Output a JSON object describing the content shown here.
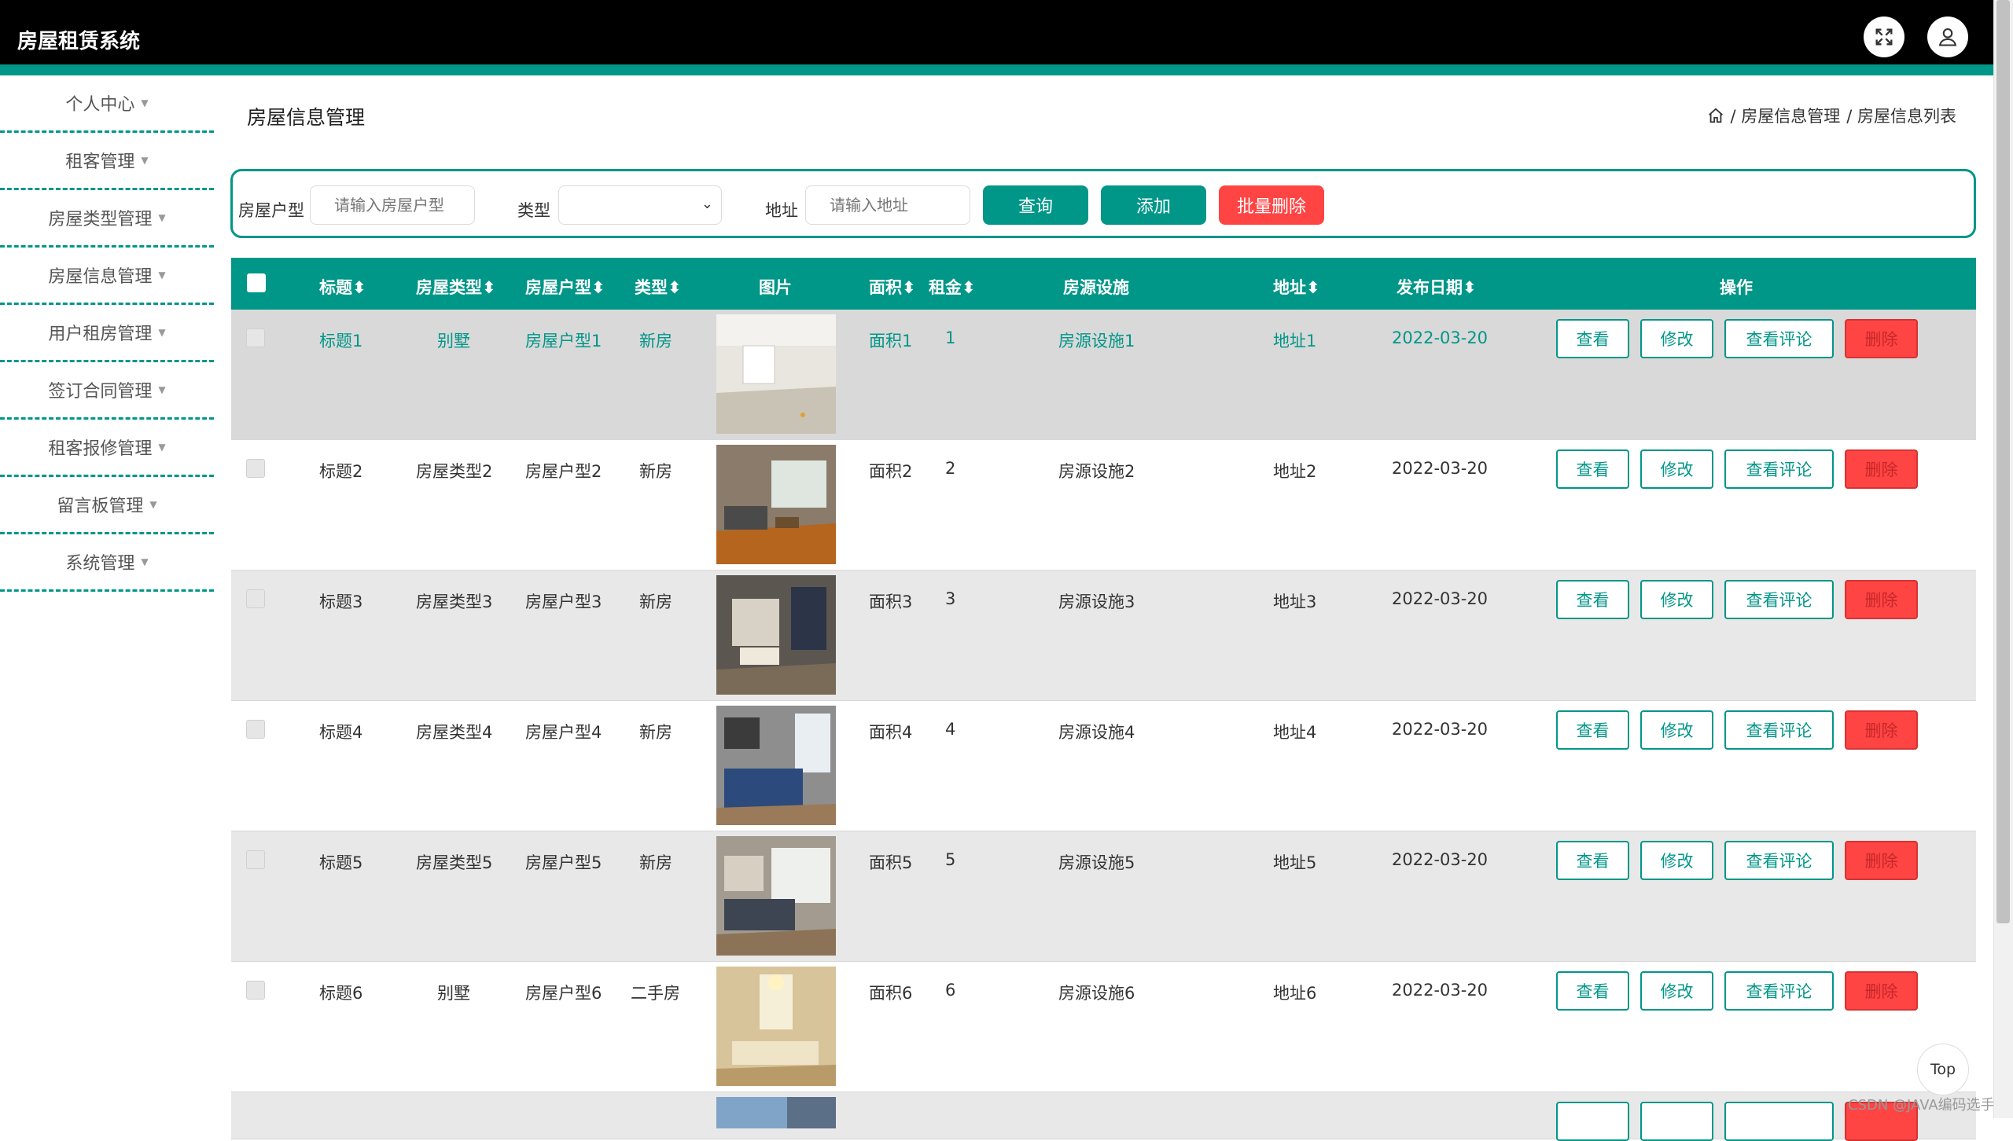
{
  "app": {
    "title": "房屋租赁系统"
  },
  "sidebar": {
    "items": [
      {
        "label": "个人中心"
      },
      {
        "label": "租客管理"
      },
      {
        "label": "房屋类型管理"
      },
      {
        "label": "房屋信息管理"
      },
      {
        "label": "用户租房管理"
      },
      {
        "label": "签订合同管理"
      },
      {
        "label": "租客报修管理"
      },
      {
        "label": "留言板管理"
      },
      {
        "label": "系统管理"
      }
    ]
  },
  "page": {
    "title": "房屋信息管理",
    "breadcrumb": [
      "/ 房屋信息管理",
      "/ 房屋信息列表"
    ]
  },
  "search": {
    "house_type_label": "房屋户型",
    "house_type_placeholder": "请输入房屋户型",
    "type_label": "类型",
    "type_value": "",
    "address_label": "地址",
    "address_placeholder": "请输入地址",
    "query_button": "查询",
    "add_button": "添加",
    "batch_delete_button": "批量删除"
  },
  "colors": {
    "accent": "#009688",
    "danger": "#ff4444",
    "header": "#000000"
  },
  "table": {
    "headers": {
      "title": "标题",
      "house_category": "房屋类型",
      "house_layout": "房屋户型",
      "type": "类型",
      "image": "图片",
      "area": "面积",
      "rent": "租金",
      "facilities": "房源设施",
      "address": "地址",
      "publish_date": "发布日期",
      "actions": "操作"
    },
    "action_labels": {
      "view": "查看",
      "edit": "修改",
      "comments": "查看评论",
      "delete": "删除"
    },
    "rows": [
      {
        "title": "标题1",
        "category": "别墅",
        "layout": "房屋户型1",
        "type": "新房",
        "area": "面积1",
        "rent": "1",
        "facilities": "房源设施1",
        "address": "地址1",
        "date": "2022-03-20"
      },
      {
        "title": "标题2",
        "category": "房屋类型2",
        "layout": "房屋户型2",
        "type": "新房",
        "area": "面积2",
        "rent": "2",
        "facilities": "房源设施2",
        "address": "地址2",
        "date": "2022-03-20"
      },
      {
        "title": "标题3",
        "category": "房屋类型3",
        "layout": "房屋户型3",
        "type": "新房",
        "area": "面积3",
        "rent": "3",
        "facilities": "房源设施3",
        "address": "地址3",
        "date": "2022-03-20"
      },
      {
        "title": "标题4",
        "category": "房屋类型4",
        "layout": "房屋户型4",
        "type": "新房",
        "area": "面积4",
        "rent": "4",
        "facilities": "房源设施4",
        "address": "地址4",
        "date": "2022-03-20"
      },
      {
        "title": "标题5",
        "category": "房屋类型5",
        "layout": "房屋户型5",
        "type": "新房",
        "area": "面积5",
        "rent": "5",
        "facilities": "房源设施5",
        "address": "地址5",
        "date": "2022-03-20"
      },
      {
        "title": "标题6",
        "category": "别墅",
        "layout": "房屋户型6",
        "type": "二手房",
        "area": "面积6",
        "rent": "6",
        "facilities": "房源设施6",
        "address": "地址6",
        "date": "2022-03-20"
      }
    ]
  },
  "back_to_top": "Top",
  "watermark": "CSDN @JAVA编码选手"
}
